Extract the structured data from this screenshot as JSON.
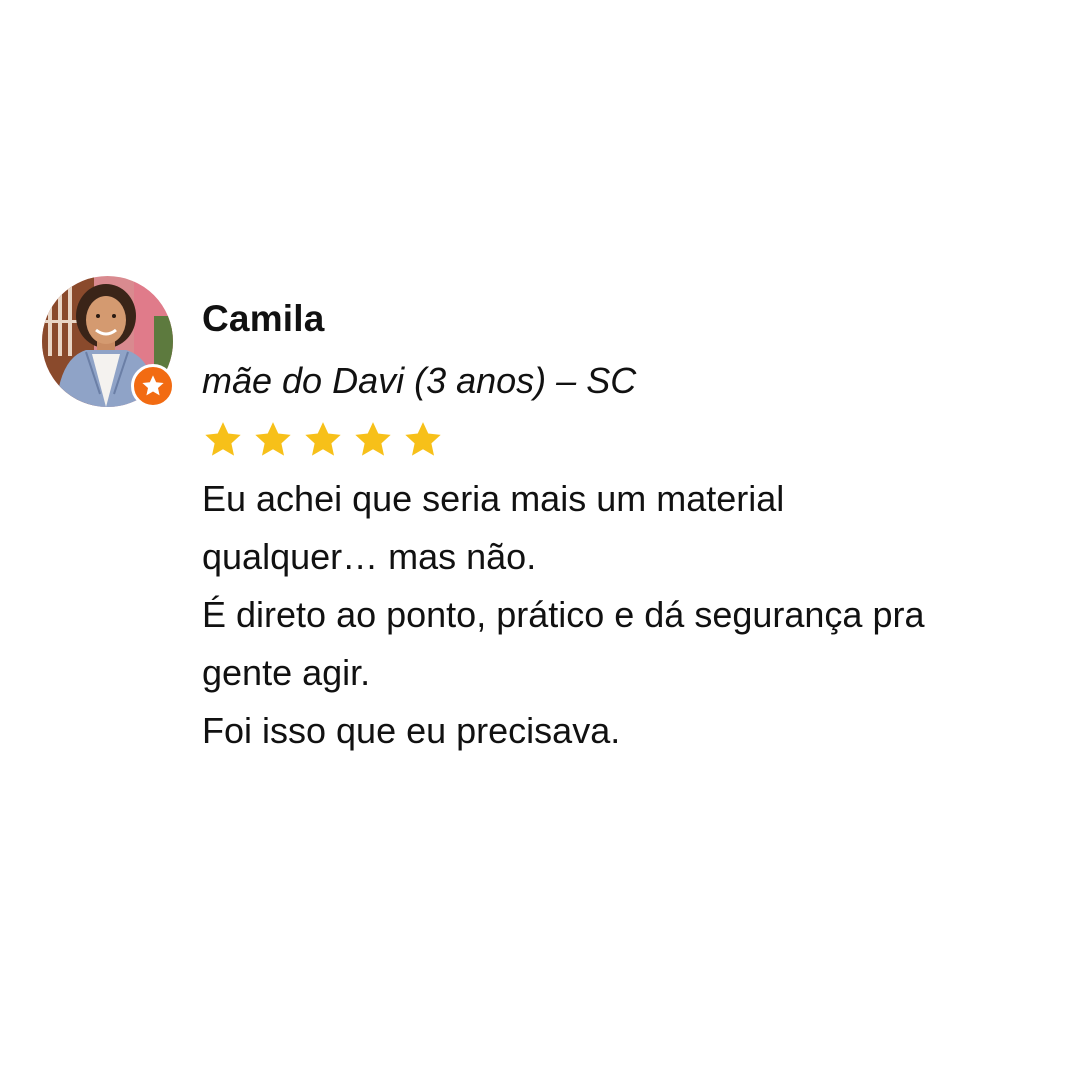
{
  "reviewer": {
    "name": "Camila",
    "subtitle": "mãe do Davi (3 anos) – SC",
    "avatar_icon": "user-photo",
    "badge_icon": "star-icon",
    "badge_color": "#f26b12"
  },
  "rating": {
    "stars": 5,
    "max": 5,
    "star_color": "#f7c019"
  },
  "review": {
    "lines": [
      "Eu achei que seria mais um material",
      "qualquer… mas não.",
      "É direto ao ponto, prático e dá segurança pra",
      "gente agir.",
      "Foi isso que eu precisava."
    ]
  }
}
